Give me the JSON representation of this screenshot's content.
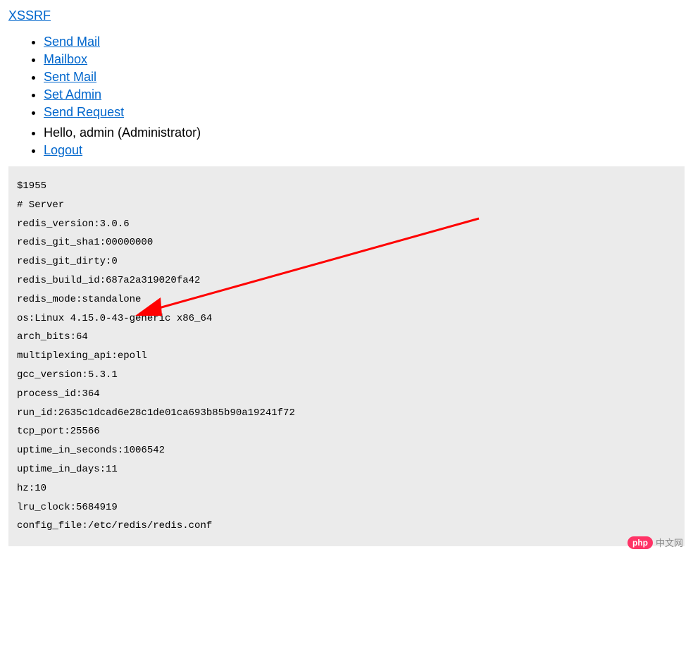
{
  "header": {
    "brand": "XSSRF"
  },
  "nav1": {
    "items": [
      {
        "label": "Send Mail"
      },
      {
        "label": "Mailbox"
      },
      {
        "label": "Sent Mail"
      },
      {
        "label": "Set Admin"
      },
      {
        "label": "Send Request"
      }
    ]
  },
  "nav2": {
    "greeting": "Hello, admin (Administrator)",
    "logout": "Logout"
  },
  "redis": {
    "first_line": "$1955",
    "section": "# Server",
    "lines": [
      "redis_version:3.0.6",
      "redis_git_sha1:00000000",
      "redis_git_dirty:0",
      "redis_build_id:687a2a319020fa42",
      "redis_mode:standalone",
      "os:Linux 4.15.0-43-generic x86_64",
      "arch_bits:64",
      "multiplexing_api:epoll",
      "gcc_version:5.3.1",
      "process_id:364",
      "run_id:2635c1dcad6e28c1de01ca693b85b90a19241f72",
      "tcp_port:25566",
      "uptime_in_seconds:1006542",
      "uptime_in_days:11",
      "hz:10",
      "lru_clock:5684919",
      "config_file:/etc/redis/redis.conf"
    ]
  },
  "watermark": {
    "badge": "php",
    "text": "中文网"
  },
  "annotation": {
    "arrow_color": "#ff0000"
  }
}
